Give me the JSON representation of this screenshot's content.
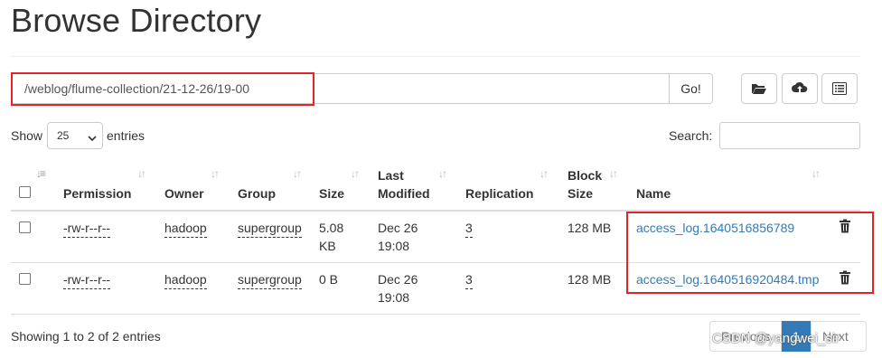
{
  "page_title": "Browse Directory",
  "path_bar": {
    "value": "/weblog/flume-collection/21-12-26/19-00",
    "go_label": "Go!"
  },
  "toolbar": {
    "icons": [
      "folder-open-icon",
      "cloud-upload-icon",
      "list-icon"
    ]
  },
  "length": {
    "show_label": "Show",
    "selected": "25",
    "entries_label": "entries"
  },
  "search": {
    "label": "Search:",
    "value": ""
  },
  "table": {
    "headers": {
      "permission": "Permission",
      "owner": "Owner",
      "group": "Group",
      "size": "Size",
      "last_modified_1": "Last",
      "last_modified_2": "Modified",
      "replication": "Replication",
      "block_size_1": "Block",
      "block_size_2": "Size",
      "name": "Name"
    },
    "rows": [
      {
        "permission": "-rw-r--r--",
        "owner": "hadoop",
        "group": "supergroup",
        "size_1": "5.08",
        "size_2": "KB",
        "date_1": "Dec 26",
        "date_2": "19:08",
        "replication": "3",
        "block_size": "128 MB",
        "name": "access_log.1640516856789"
      },
      {
        "permission": "-rw-r--r--",
        "owner": "hadoop",
        "group": "supergroup",
        "size_1": "0 B",
        "size_2": "",
        "date_1": "Dec 26",
        "date_2": "19:08",
        "replication": "3",
        "block_size": "128 MB",
        "name": "access_log.1640516920484.tmp"
      }
    ]
  },
  "info": "Showing 1 to 2 of 2 entries",
  "pagination": {
    "previous": "Previous",
    "current": "1",
    "next": "Next"
  },
  "watermark": "CSDN @yangwei_sir",
  "colors": {
    "link": "#337ab7",
    "highlight_box": "#e0242b",
    "pager_active": "#337ab7"
  }
}
